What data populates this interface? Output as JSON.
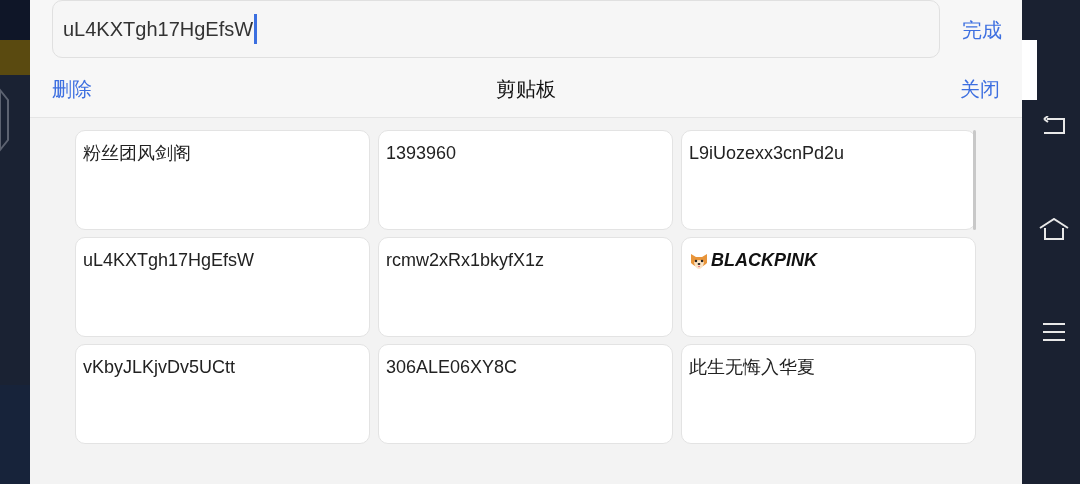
{
  "input": {
    "value": "uL4KXTgh17HgEfsW"
  },
  "done_button": "完成",
  "toolbar": {
    "delete": "删除",
    "title": "剪贴板",
    "close": "关闭"
  },
  "clips": [
    {
      "kind": "plain",
      "text": "粉丝团风剑阁"
    },
    {
      "kind": "plain",
      "text": "1393960"
    },
    {
      "kind": "plain",
      "text": "L9iUozexx3cnPd2u"
    },
    {
      "kind": "plain",
      "text": "uL4KXTgh17HgEfsW"
    },
    {
      "kind": "plain",
      "text": "rcmw2xRx1bkyfX1z"
    },
    {
      "kind": "emoji",
      "text": "BLACKPINK"
    },
    {
      "kind": "plain",
      "text": "vKbyJLKjvDv5UCtt"
    },
    {
      "kind": "plain",
      "text": "306ALE06XY8C"
    },
    {
      "kind": "plain",
      "text": "此生无悔入华夏"
    }
  ]
}
